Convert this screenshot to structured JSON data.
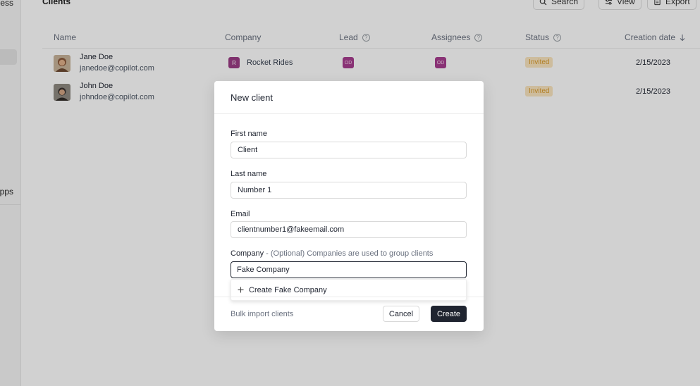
{
  "sidebar": {
    "item_top": "ness",
    "item_apps": "pps"
  },
  "page": {
    "title": "Clients",
    "search_label": "Search",
    "view_label": "View",
    "export_label": "Export"
  },
  "table": {
    "headers": {
      "name": "Name",
      "company": "Company",
      "lead": "Lead",
      "assignees": "Assignees",
      "status": "Status",
      "creation_date": "Creation date"
    },
    "rows": [
      {
        "name": "Jane Doe",
        "email": "janedoe@copilot.com",
        "company_initial": "R",
        "company": "Rocket Rides",
        "lead_initials": "OD",
        "assignee_initials": "OD",
        "status": "Invited",
        "date": "2/15/2023"
      },
      {
        "name": "John Doe",
        "email": "johndoe@copilot.com",
        "status": "Invited",
        "date": "2/15/2023"
      }
    ]
  },
  "modal": {
    "title": "New client",
    "first_name_label": "First name",
    "first_name_value": "Client",
    "last_name_label": "Last name",
    "last_name_value": "Number 1",
    "email_label": "Email",
    "email_value": "clientnumber1@fakeemail.com",
    "company_label": "Company",
    "company_hint": " - (Optional) Companies are used to group clients",
    "company_value": "Fake Company",
    "dropdown_option": "Create Fake Company",
    "bulk_import": "Bulk import clients",
    "cancel": "Cancel",
    "create": "Create"
  },
  "colors": {
    "primary_button": "#1f2430",
    "status_invited_bg": "#fbe6c0",
    "status_invited_text": "#d99a2b",
    "badge_purple": "#9b3c86"
  }
}
